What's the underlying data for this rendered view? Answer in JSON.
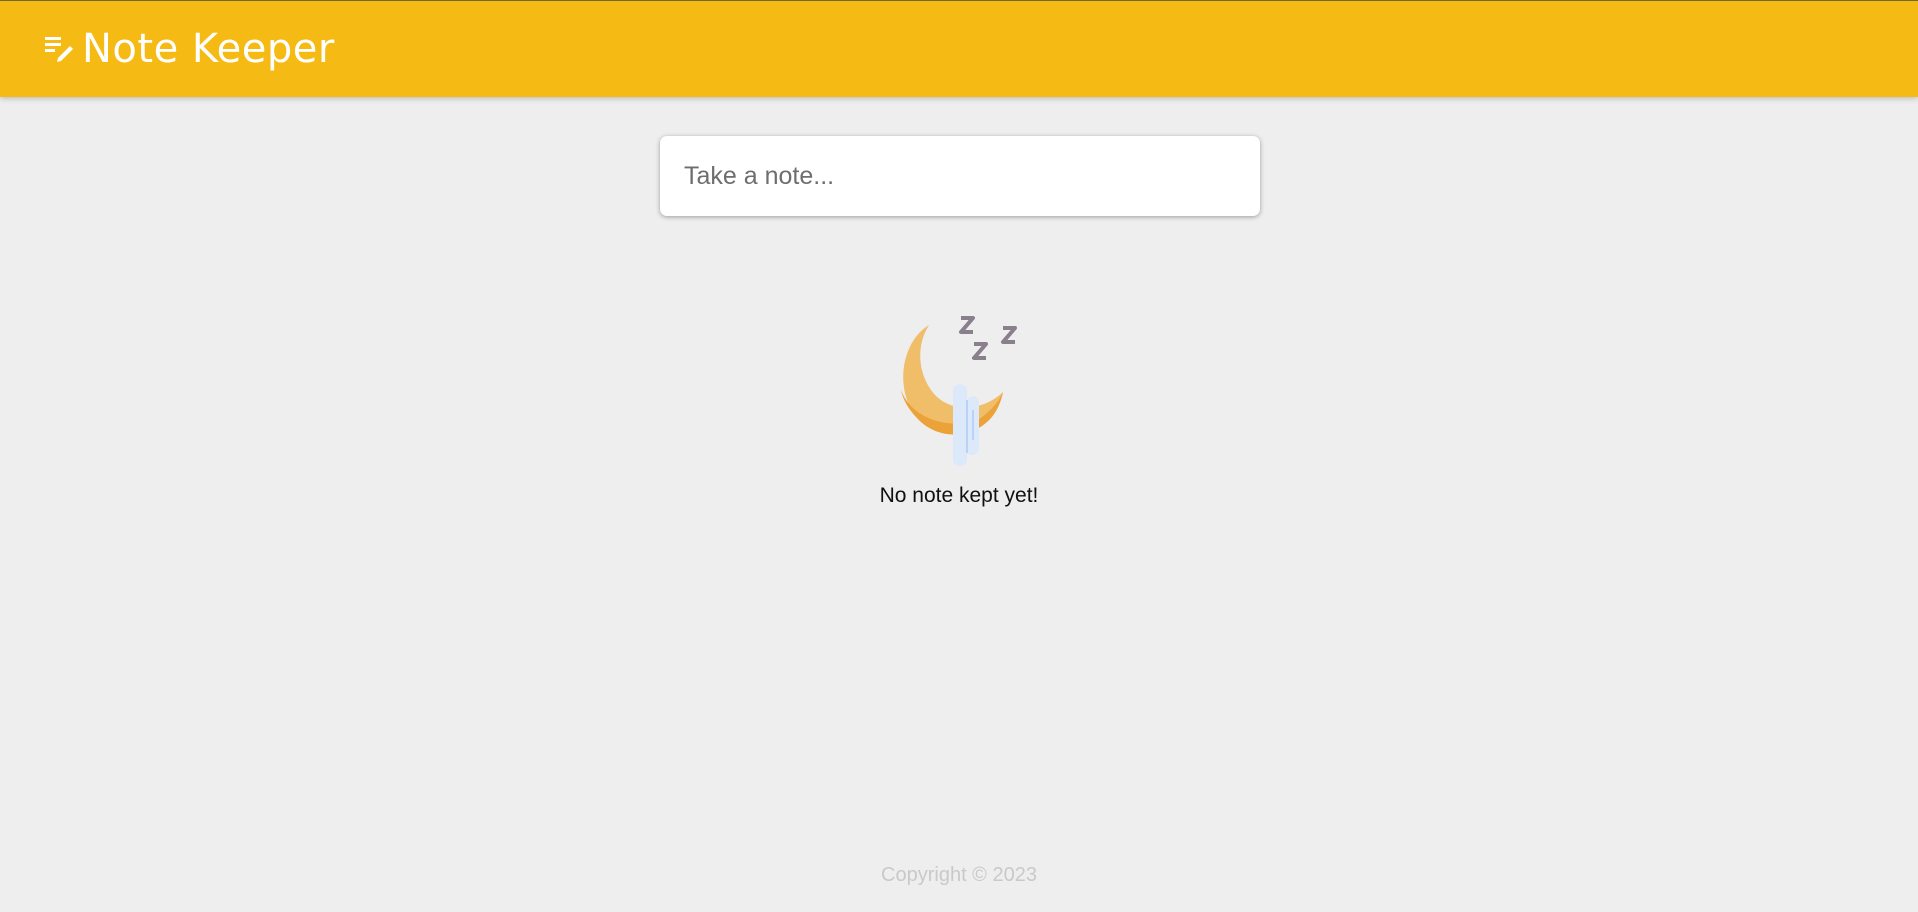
{
  "header": {
    "title": "Note Keeper",
    "icon": "note-edit-icon",
    "background_color": "#f5ba13",
    "text_color": "#ffffff"
  },
  "note_input": {
    "placeholder": "Take a note...",
    "value": ""
  },
  "empty_state": {
    "illustration": "sleeping-moon-icon",
    "message": "No note kept yet!"
  },
  "footer": {
    "text": "Copyright © 2023"
  },
  "colors": {
    "page_background": "#eeeeee",
    "accent": "#f5ba13",
    "moon": "#f0bd69",
    "zzz": "#8a7f8c",
    "cloud": "#dce9fb"
  }
}
